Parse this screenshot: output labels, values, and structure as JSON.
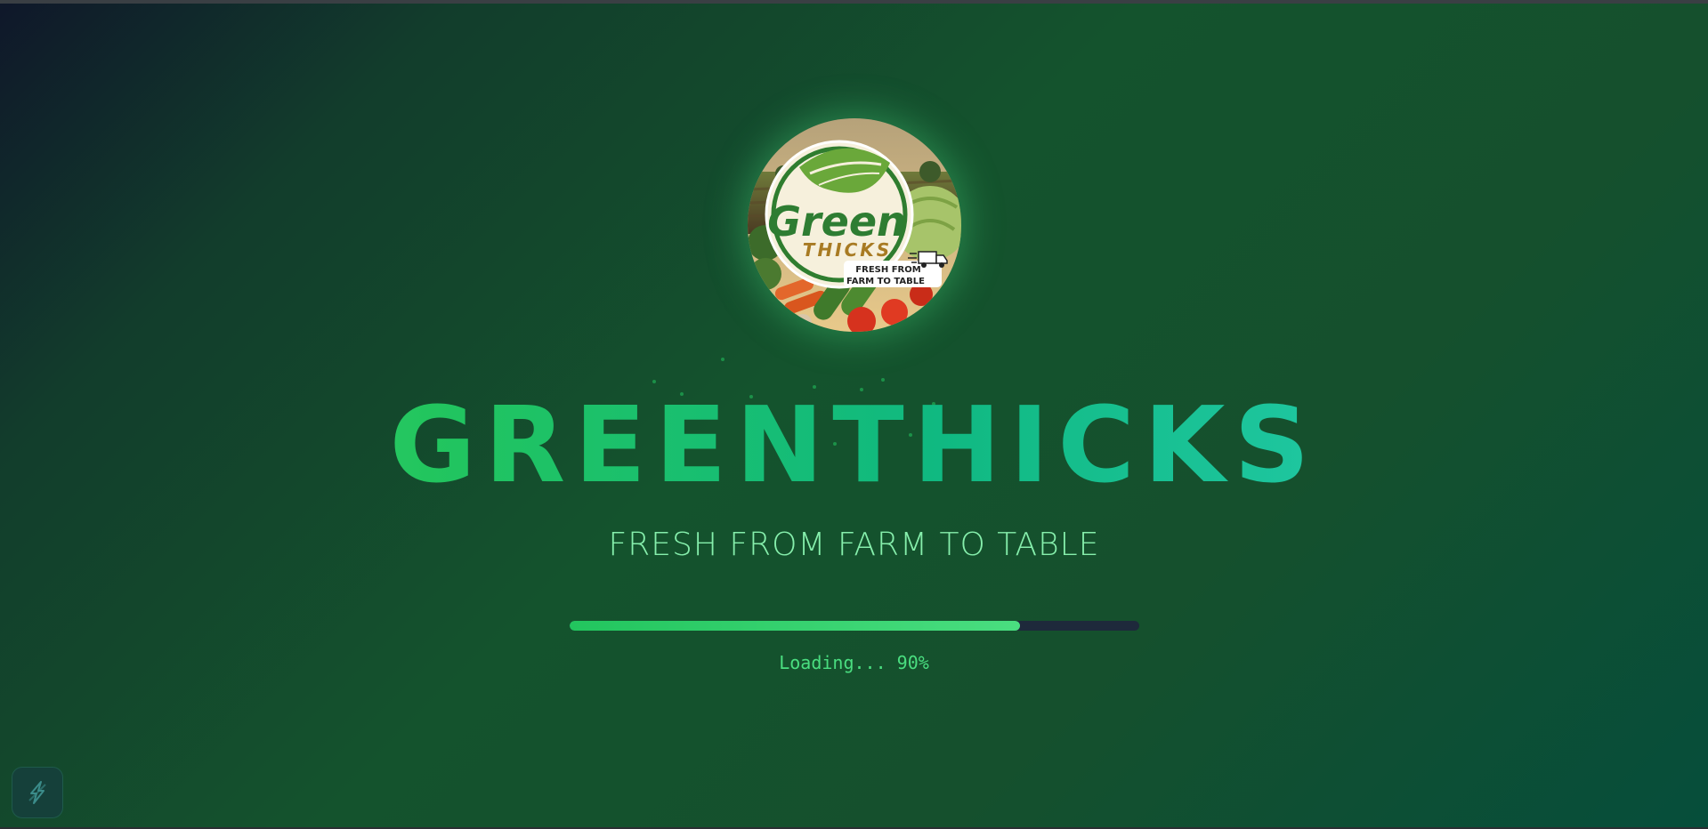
{
  "brand": {
    "name": "GREENTHICKS",
    "tagline": "FRESH FROM FARM TO TABLE"
  },
  "logo": {
    "word_main": "Green",
    "word_sub": "THICKS",
    "badge_line1": "FRESH FROM",
    "badge_line2": "FARM TO TABLE",
    "icon": "delivery-truck-icon"
  },
  "loading": {
    "text": "Loading... 90%",
    "progress": 0.79
  },
  "corner_button": {
    "icon": "lightning-bolt-icon"
  },
  "colors": {
    "accent": "#4ade80",
    "accent_dark": "#22c55e",
    "teal": "#2dd4bf",
    "track": "#1e293b",
    "tagline": "#86efac"
  }
}
